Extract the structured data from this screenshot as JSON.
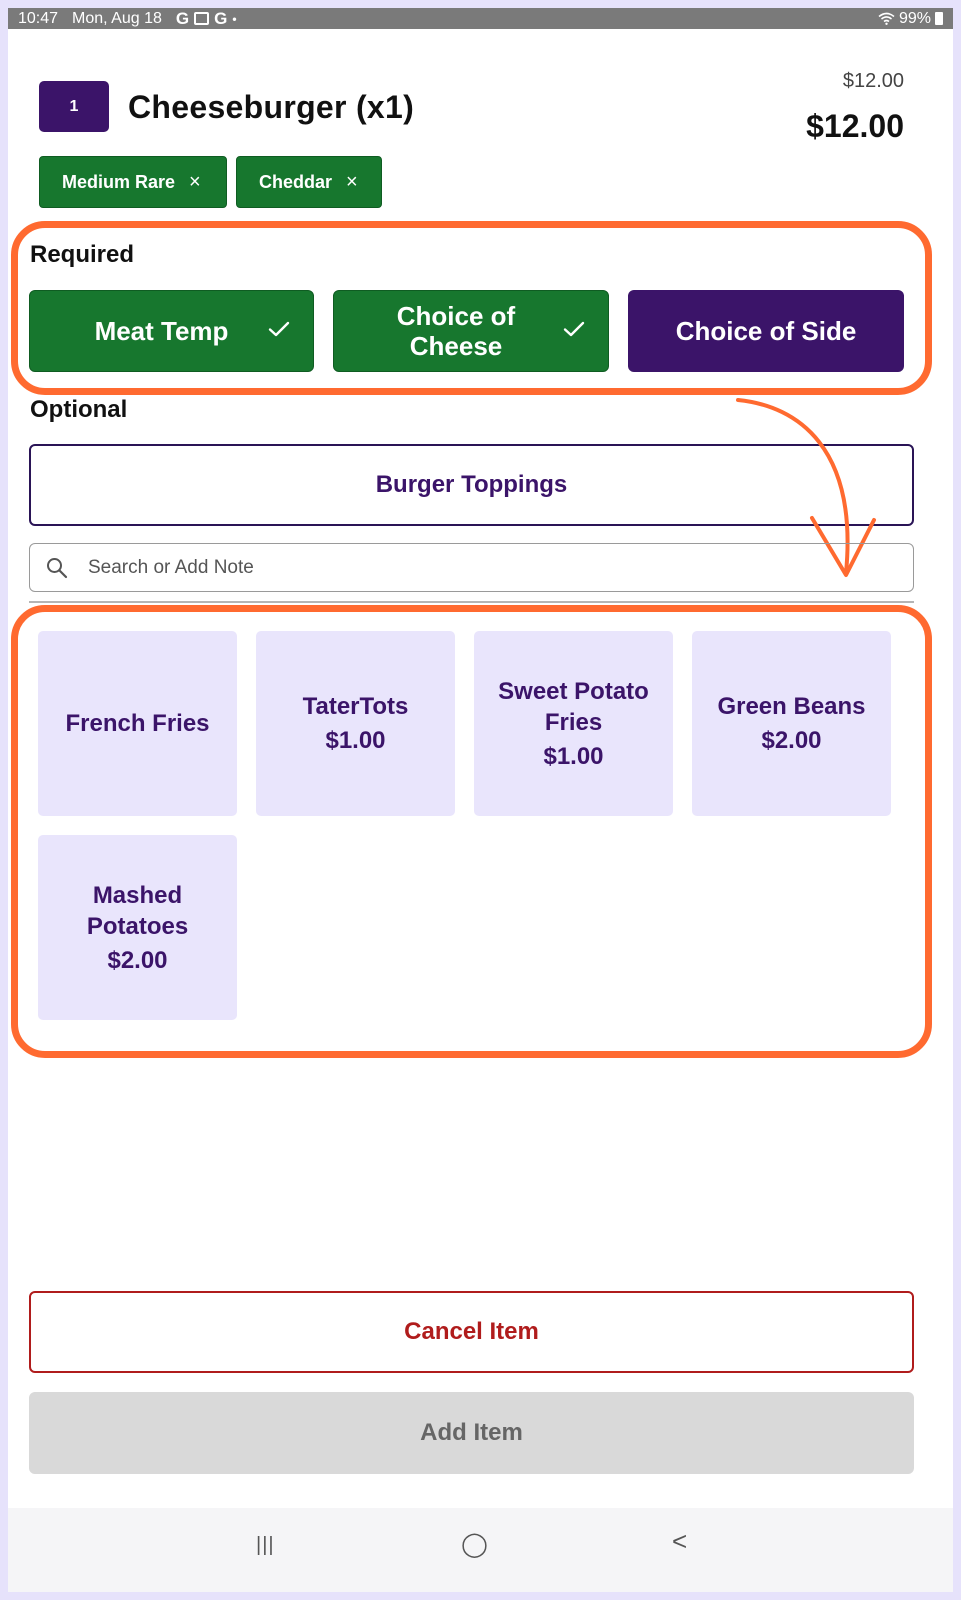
{
  "status_bar": {
    "time": "10:47",
    "date": "Mon, Aug 18",
    "app_icons": [
      "G",
      "G"
    ],
    "dot": "•",
    "battery": "99%"
  },
  "order_item": {
    "quantity": "1",
    "title": "Cheeseburger (x1)",
    "price_small": "$12.00",
    "price_total": "$12.00",
    "modifiers": [
      {
        "label": "Medium Rare",
        "remove": "×"
      },
      {
        "label": "Cheddar",
        "remove": "×"
      }
    ]
  },
  "required": {
    "label": "Required",
    "groups": [
      {
        "label": "Meat Temp",
        "state": "complete"
      },
      {
        "label": "Choice of Cheese",
        "state": "complete"
      },
      {
        "label": "Choice of Side",
        "state": "active"
      }
    ]
  },
  "optional": {
    "label": "Optional",
    "groups": [
      {
        "label": "Burger Toppings"
      }
    ]
  },
  "search": {
    "placeholder": "Search or Add Note",
    "value": ""
  },
  "options": [
    {
      "name": "French Fries",
      "price": ""
    },
    {
      "name": "TaterTots",
      "price": "$1.00"
    },
    {
      "name": "Sweet Potato Fries",
      "price": "$1.00"
    },
    {
      "name": "Green Beans",
      "price": "$2.00"
    },
    {
      "name": "Mashed Potatoes",
      "price": "$2.00"
    }
  ],
  "actions": {
    "cancel_label": "Cancel Item",
    "add_label": "Add Item",
    "add_enabled": false
  },
  "nav": {
    "recents": "|||",
    "home": "◯",
    "back": "<"
  },
  "colors": {
    "accent_purple": "#3b1469",
    "success_green": "#17772e",
    "danger_red": "#b01c1c",
    "tile_bg": "#e9e5fc",
    "annotation_orange": "#ff6a30"
  }
}
